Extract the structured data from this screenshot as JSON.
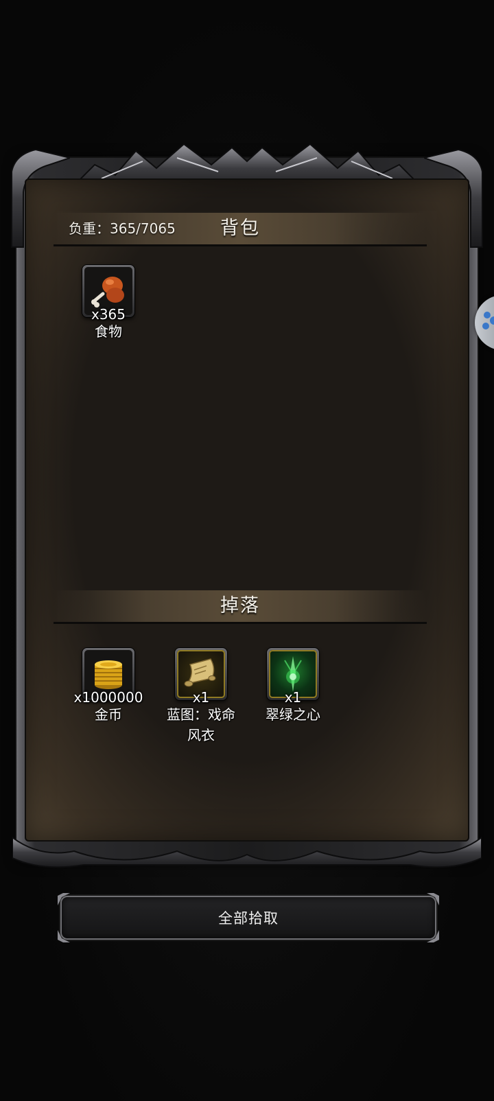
{
  "inventory": {
    "title": "背包",
    "weight_label": "负重：365/7065",
    "items": [
      {
        "name": "食物",
        "quantity": "x365",
        "icon": "food-drumstick-icon"
      }
    ]
  },
  "drops": {
    "title": "掉落",
    "items": [
      {
        "name": "金币",
        "quantity": "x1000000",
        "icon": "gold-coins-icon"
      },
      {
        "name": "蓝图：戏命",
        "name_line2": "风衣",
        "quantity": "x1",
        "icon": "blueprint-scroll-icon"
      },
      {
        "name": "翠绿之心",
        "quantity": "x1",
        "icon": "emerald-heart-icon"
      }
    ]
  },
  "actions": {
    "pickup_all_label": "全部拾取"
  },
  "colors": {
    "panel_bg": "#1e1a16",
    "header_bar": "#5a4c38",
    "frame_metal": "#6d6d72",
    "text": "#f4f1ea"
  }
}
